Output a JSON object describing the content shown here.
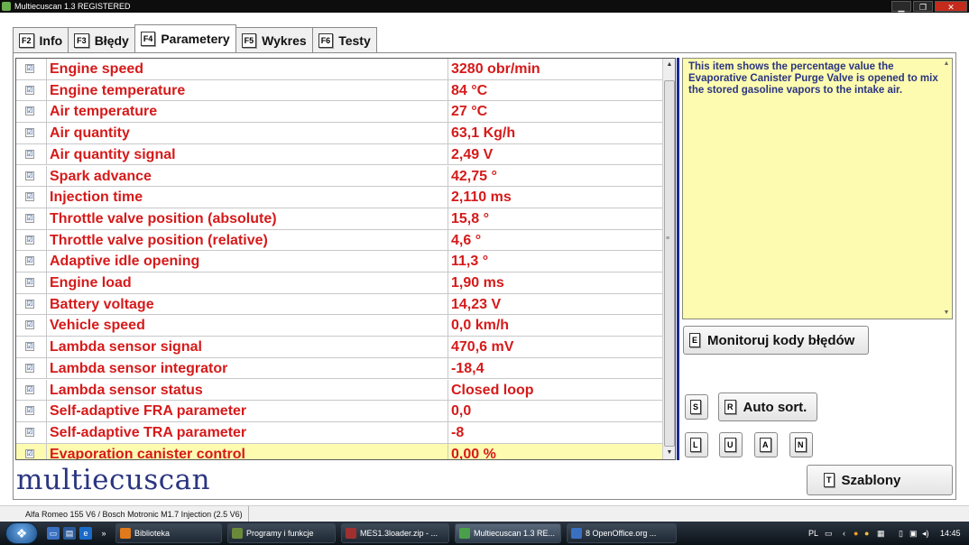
{
  "window": {
    "title": "Multiecuscan 1.3 REGISTERED",
    "min_label": "▁",
    "max_label": "❐",
    "close_label": "✕"
  },
  "tabs": [
    {
      "key": "F2",
      "label": "Info"
    },
    {
      "key": "F3",
      "label": "Błędy"
    },
    {
      "key": "F4",
      "label": "Parametery"
    },
    {
      "key": "F5",
      "label": "Wykres"
    },
    {
      "key": "F6",
      "label": "Testy"
    }
  ],
  "parameters": [
    {
      "checked": "☑",
      "name": "Engine speed",
      "value": "3280 obr/min"
    },
    {
      "checked": "☑",
      "name": "Engine temperature",
      "value": "84 °C"
    },
    {
      "checked": "☑",
      "name": "Air temperature",
      "value": "27 °C"
    },
    {
      "checked": "☑",
      "name": "Air quantity",
      "value": "63,1 Kg/h"
    },
    {
      "checked": "☑",
      "name": "Air quantity signal",
      "value": "2,49 V"
    },
    {
      "checked": "☑",
      "name": "Spark advance",
      "value": "42,75 °"
    },
    {
      "checked": "☑",
      "name": "Injection time",
      "value": "2,110 ms"
    },
    {
      "checked": "☑",
      "name": "Throttle valve position (absolute)",
      "value": "15,8 °"
    },
    {
      "checked": "☑",
      "name": "Throttle valve position (relative)",
      "value": "4,6 °"
    },
    {
      "checked": "☑",
      "name": "Adaptive idle opening",
      "value": "11,3 °"
    },
    {
      "checked": "☑",
      "name": "Engine load",
      "value": "1,90 ms"
    },
    {
      "checked": "☑",
      "name": "Battery voltage",
      "value": "14,23 V"
    },
    {
      "checked": "☑",
      "name": "Vehicle speed",
      "value": "0,0 km/h"
    },
    {
      "checked": "☑",
      "name": "Lambda sensor signal",
      "value": "470,6 mV"
    },
    {
      "checked": "☑",
      "name": "Lambda sensor integrator",
      "value": "-18,4"
    },
    {
      "checked": "☑",
      "name": "Lambda sensor status",
      "value": "Closed loop"
    },
    {
      "checked": "☑",
      "name": "Self-adaptive FRA parameter",
      "value": "0,0"
    },
    {
      "checked": "☑",
      "name": "Self-adaptive TRA parameter",
      "value": "-8"
    },
    {
      "checked": "☑",
      "name": "Evaporation canister control",
      "value": "0,00 %"
    }
  ],
  "selected_index": 18,
  "description": "This item shows the percentage value the Evaporative Canister Purge Valve is opened to mix the stored gasoline vapors to the intake air.",
  "buttons": {
    "monitor": {
      "key": "E",
      "label": "Monitoruj kody błędów"
    },
    "s": {
      "key": "S"
    },
    "auto_sort": {
      "key": "R",
      "label": "Auto sort."
    },
    "l": {
      "key": "L"
    },
    "u": {
      "key": "U"
    },
    "a": {
      "key": "A"
    },
    "n": {
      "key": "N"
    },
    "templates": {
      "key": "T",
      "label": "Szablony"
    }
  },
  "logo": "multiecuscan",
  "status": "Alfa Romeo 155 V6 / Bosch Motronic M1.7 Injection (2.5 V6)",
  "taskbar": {
    "chevron": "»",
    "items": [
      {
        "label": "Biblioteka",
        "icon_color": "#e07a1a"
      },
      {
        "label": "Programy i funkcje",
        "icon_color": "#6a8a3a"
      },
      {
        "label": "MES1.3loader.zip - ...",
        "icon_color": "#a03030"
      },
      {
        "label": "Multiecuscan 1.3 RE...",
        "icon_color": "#4aa04a"
      },
      {
        "label": "8 OpenOffice.org ...",
        "icon_color": "#3a70c0"
      }
    ],
    "tray_lang": "PL",
    "clock": "14:45"
  },
  "colors": {
    "param_text": "#d61a1a",
    "selected_row": "#fdfbb0",
    "desc_text": "#2a3580",
    "accent_divider": "#1b2a8f"
  }
}
